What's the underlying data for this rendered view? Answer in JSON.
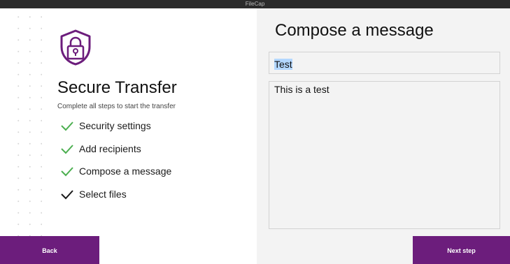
{
  "window": {
    "title": "FileCap"
  },
  "sidebar": {
    "heading": "Secure Transfer",
    "subheading": "Complete all steps to start the transfer",
    "steps": [
      {
        "label": "Security settings",
        "state": "complete",
        "check_color": "#4caf50"
      },
      {
        "label": "Add recipients",
        "state": "complete",
        "check_color": "#4caf50"
      },
      {
        "label": "Compose a message",
        "state": "complete",
        "check_color": "#4caf50"
      },
      {
        "label": "Select files",
        "state": "pending",
        "check_color": "#1a1a1a"
      }
    ],
    "icon": "shield-lock-icon",
    "back_label": "Back"
  },
  "compose": {
    "title": "Compose a message",
    "subject_value": "Test",
    "message_value": "This is a test",
    "next_label": "Next step"
  },
  "colors": {
    "brand": "#6c1d7c",
    "check_complete": "#4caf50",
    "titlebar": "#2b2b2b",
    "right_panel": "#f3f3f3"
  }
}
